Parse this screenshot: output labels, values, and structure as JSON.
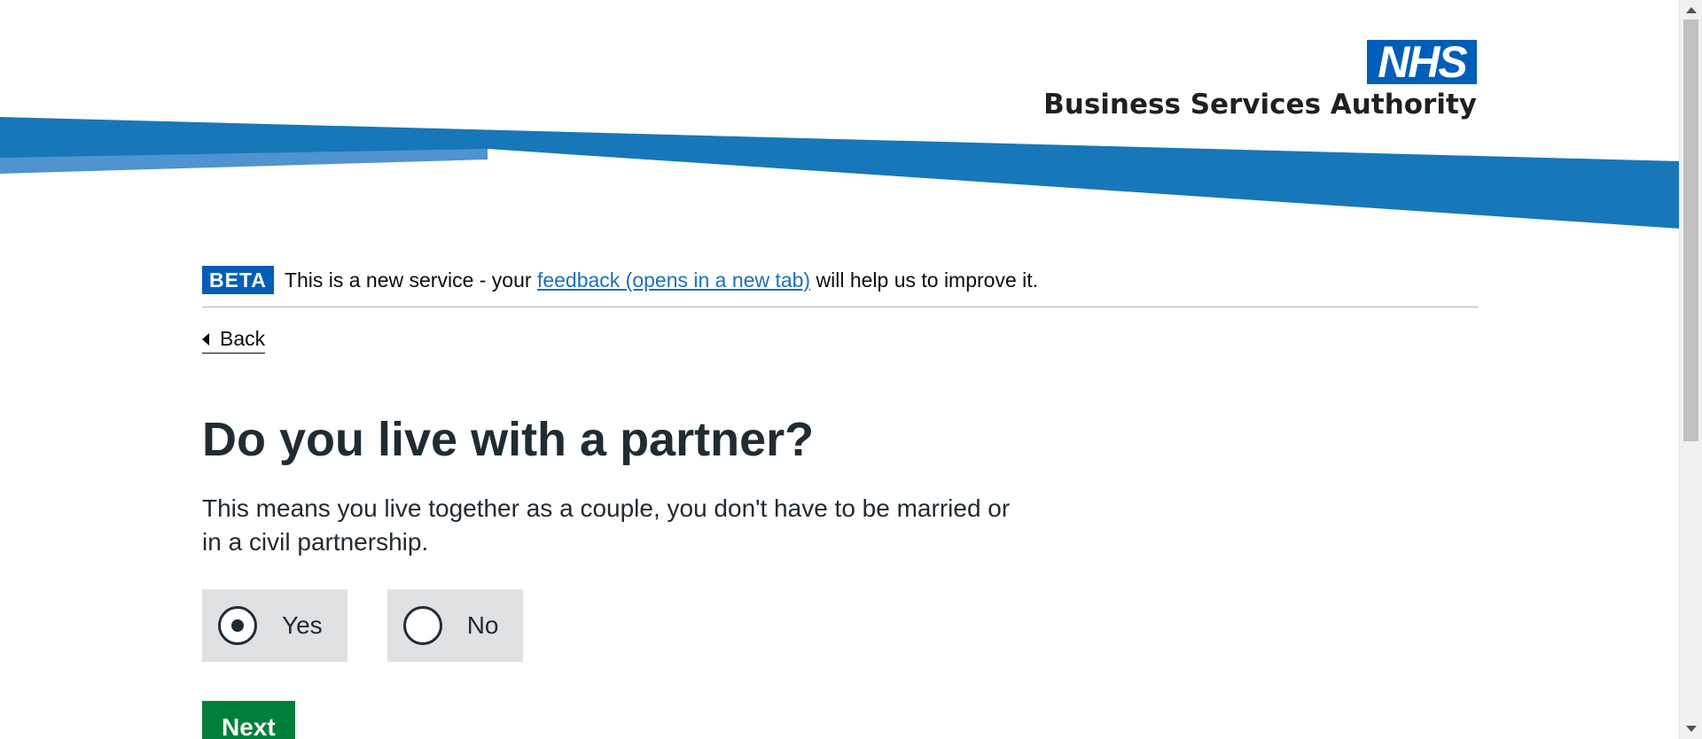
{
  "header": {
    "logo_text": "NHS",
    "org_name": "Business Services Authority",
    "colors": {
      "nhs_blue": "#005eb8",
      "wave_dark": "#1075b9",
      "wave_light": "#4f93cf"
    }
  },
  "beta_banner": {
    "tag": "BETA",
    "text_before": "This is a new service - your",
    "link_text": "feedback (opens in a new tab)",
    "text_after": "will help us to improve it."
  },
  "back_link": {
    "label": "Back",
    "icon": "chevron-left-icon"
  },
  "question": {
    "title": "Do you live with a partner?",
    "hint": "This means you live together as a couple, you don't have to be married or in a civil partnership.",
    "options": [
      {
        "label": "Yes",
        "selected": true
      },
      {
        "label": "No",
        "selected": false
      }
    ]
  },
  "actions": {
    "next_label": "Next",
    "next_color": "#007f3b"
  }
}
